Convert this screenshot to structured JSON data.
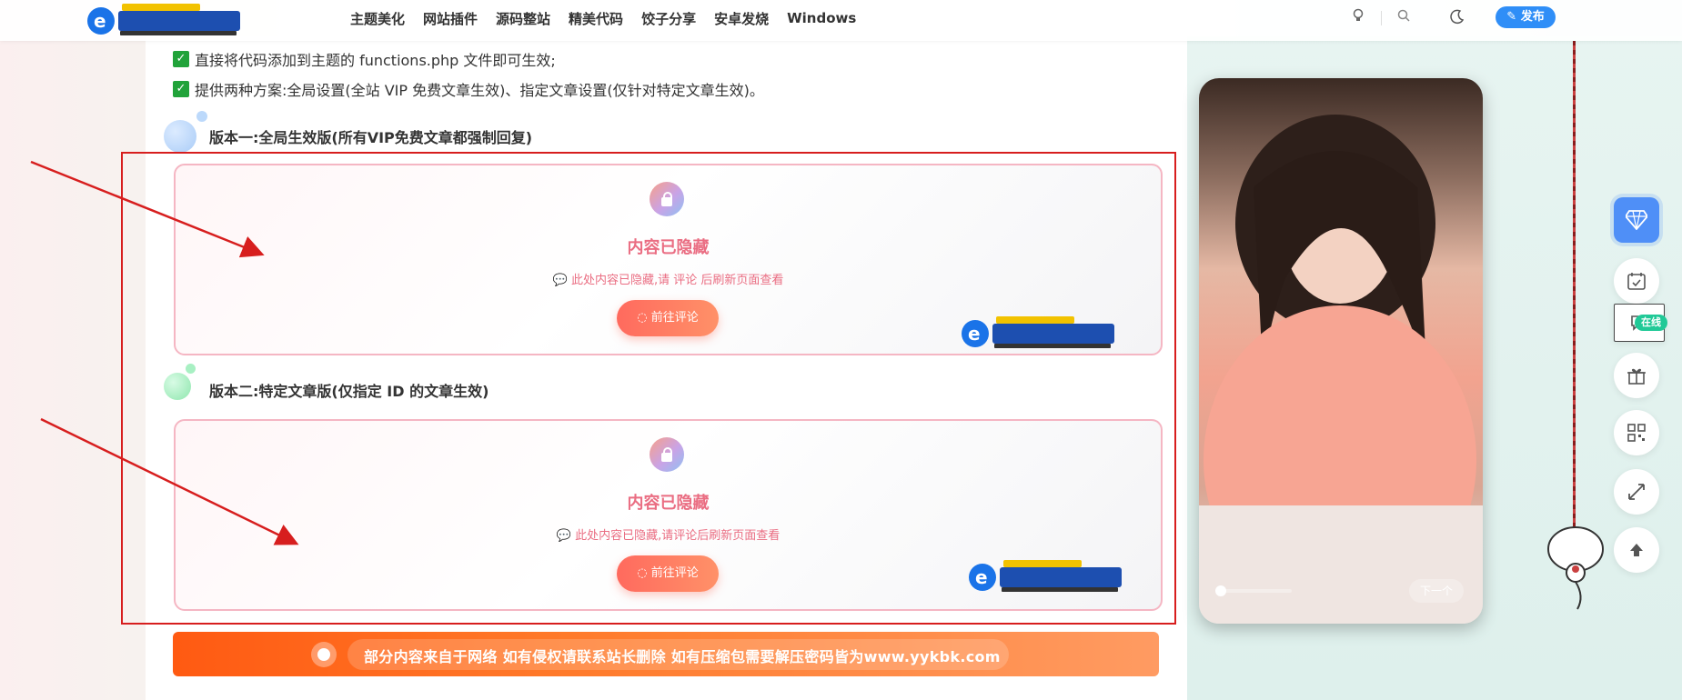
{
  "nav": {
    "items": [
      "主题美化",
      "网站插件",
      "源码整站",
      "精美代码",
      "饺子分享",
      "安卓发烧",
      "Windows"
    ],
    "publish_label": "发布"
  },
  "content": {
    "checks": [
      "直接将代码添加到主题的 functions.php 文件即可生效;",
      "提供两种方案:全局设置(全站 VIP 免费文章生效)、指定文章设置(仅针对特定文章生效)。"
    ],
    "section1_title": "版本一:全局生效版(所有VIP免费文章都强制回复)",
    "section2_title": "版本二:特定文章版(仅指定 ID 的文章生效)",
    "hidden_title": "内容已隐藏",
    "hidden_note_1": "此处内容已隐藏,请 评论 后刷新页面查看",
    "hidden_note_2": "此处内容已隐藏,请评论后刷新页面查看",
    "comment_button": "前往评论",
    "notice": "部分内容来自于网络 如有侵权请联系站长删除 如有压缩包需要解压密码皆为www.yykbk.com"
  },
  "sidebar": {
    "next_label": "下一个",
    "online_badge": "在线"
  },
  "colors": {
    "accent_blue": "#2f8ef7",
    "hidden_pink": "#ea6d82",
    "frame_red": "#d71e1e",
    "notice_orange": "#ff5a12"
  }
}
